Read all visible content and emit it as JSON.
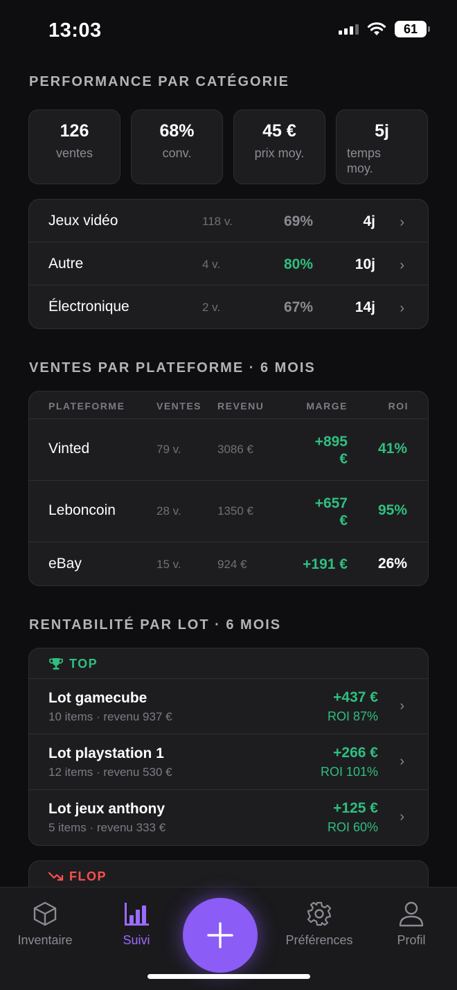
{
  "status": {
    "time": "13:03",
    "battery": "61"
  },
  "category_section": {
    "title": "PERFORMANCE PAR CATÉGORIE",
    "stats": [
      {
        "value": "126",
        "label": "ventes"
      },
      {
        "value": "68%",
        "label": "conv."
      },
      {
        "value": "45 €",
        "label": "prix moy."
      },
      {
        "value": "5j",
        "label": "temps moy."
      }
    ],
    "rows": [
      {
        "name": "Jeux vidéo",
        "count": "118 v.",
        "pct": "69%",
        "days": "4j"
      },
      {
        "name": "Autre",
        "count": "4 v.",
        "pct": "80%",
        "days": "10j"
      },
      {
        "name": "Électronique",
        "count": "2 v.",
        "pct": "67%",
        "days": "14j"
      }
    ]
  },
  "platform_section": {
    "title": "VENTES PAR PLATEFORME · 6 MOIS",
    "headers": {
      "platform": "PLATEFORME",
      "sales": "VENTES",
      "revenue": "REVENU",
      "margin": "MARGE",
      "roi": "ROI"
    },
    "rows": [
      {
        "name": "Vinted",
        "sales": "79 v.",
        "revenue": "3086 €",
        "margin_line1": "+895",
        "margin_line2": "€",
        "roi": "41%"
      },
      {
        "name": "Leboncoin",
        "sales": "28 v.",
        "revenue": "1350 €",
        "margin_line1": "+657",
        "margin_line2": "€",
        "roi": "95%"
      },
      {
        "name": "eBay",
        "sales": "15 v.",
        "revenue": "924 €",
        "margin_line1": "+191 €",
        "margin_line2": "",
        "roi": "26%"
      }
    ]
  },
  "lot_section": {
    "title": "RENTABILITÉ PAR LOT · 6 MOIS",
    "top_label": "TOP",
    "flop_label": "FLOP",
    "top_lots": [
      {
        "name": "Lot gamecube",
        "sub": "10 items · revenu 937 €",
        "profit": "+437 €",
        "roi": "ROI 87%"
      },
      {
        "name": "Lot playstation 1",
        "sub": "12 items · revenu 530 €",
        "profit": "+266 €",
        "roi": "ROI 101%"
      },
      {
        "name": "Lot jeux anthony",
        "sub": "5 items · revenu 333 €",
        "profit": "+125 €",
        "roi": "ROI 60%"
      }
    ]
  },
  "tabbar": {
    "tabs": [
      {
        "label": "Inventaire",
        "icon": "box-icon"
      },
      {
        "label": "Suivi",
        "icon": "bar-chart-icon"
      },
      {
        "label": "Préférences",
        "icon": "gear-icon"
      },
      {
        "label": "Profil",
        "icon": "person-icon"
      }
    ],
    "active_tab": "Suivi",
    "fab_icon": "plus-icon"
  },
  "colors": {
    "accent": "#8b5cf6",
    "positive": "#2fbf7f",
    "negative": "#ff4d4d",
    "background": "#0e0e10",
    "card": "#1d1d20"
  }
}
